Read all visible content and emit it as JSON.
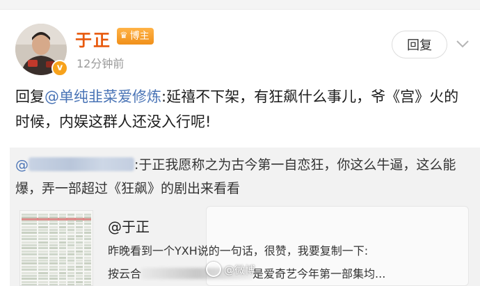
{
  "post": {
    "username": "于正",
    "badge_label": "博主",
    "verified_symbol": "v",
    "timestamp": "12分钟前",
    "reply_label": "回复",
    "text_prefix": "回复",
    "text_mention": "@单纯韭菜爱修炼",
    "text_body": ":延禧不下架，有狂飙什么事儿，爷《宫》火的时候，内娱这群人还没入行呢!"
  },
  "quote": {
    "at_symbol": "@",
    "text": ":于正我愿称之为古今第一自恋狂，你这么牛逼，这么能爆，弄一部超过《狂飙》的剧出来看看"
  },
  "card": {
    "title": "@于正",
    "line1": "昨晚看到一个YXH说的一句话，很赞，我要复制一下:",
    "line2_start": "按云合",
    "line2_end": "是爱奇艺今年第一部集均..."
  },
  "watermark": {
    "text": "@微博"
  },
  "colors": {
    "username": "#e8590c",
    "mention": "#4a74b6",
    "badge": "#f0901a"
  },
  "icons": {
    "verified": "verified-badge-icon",
    "crown": "crown-icon",
    "chevron": "chevron-down-icon"
  }
}
